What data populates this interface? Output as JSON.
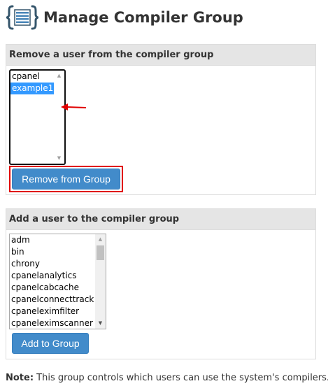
{
  "header": {
    "title": "Manage Compiler Group",
    "icon": "list-braces-icon"
  },
  "remove_panel": {
    "heading": "Remove a user from the compiler group",
    "users": [
      "cpanel",
      "example1"
    ],
    "selected_user": "example1",
    "button_label": "Remove from Group"
  },
  "add_panel": {
    "heading": "Add a user to the compiler group",
    "users": [
      "adm",
      "bin",
      "chrony",
      "cpanelanalytics",
      "cpanelcabcache",
      "cpanelconnecttrack",
      "cpaneleximfilter",
      "cpaneleximscanner"
    ],
    "button_label": "Add to Group"
  },
  "note": {
    "label": "Note:",
    "text": " This group controls which users can use the system's compilers."
  },
  "colors": {
    "button": "#428bca",
    "selection": "#3399ff",
    "highlight": "#e00000",
    "icon": "#35556b"
  }
}
